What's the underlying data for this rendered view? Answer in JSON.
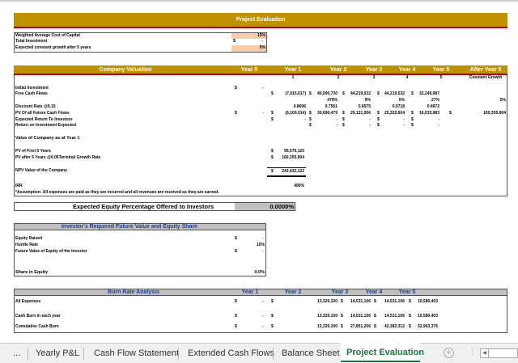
{
  "title": "Project Evaluation",
  "colors": {
    "header": "#bf9000",
    "header_border": "#b00000",
    "input_fill": "#f8cbad",
    "gray": "#c0c0c0",
    "tab_active": "#217346",
    "blue_text": "#1f3f8f"
  },
  "inputs": {
    "wacc_label": "Weighted Average Cost of Capital",
    "wacc": "15%",
    "investment_label": "Total Investment",
    "investment_cur": "$",
    "investment": "-",
    "growth_label": "Expected constant growth after 5 years",
    "growth": "5%"
  },
  "valuation": {
    "title": "Company Valuation",
    "columns": [
      "Year 0",
      "Year 1",
      "Year 2",
      "Year 3",
      "Year 4",
      "Year 5",
      "After Year 5"
    ],
    "period_numbers": [
      "1",
      "2",
      "3",
      "4",
      "5",
      "Constant Growth"
    ],
    "initial_investment": {
      "label": "Initial Investment",
      "cur": "$",
      "value": "-"
    },
    "fcf": {
      "label": "Free Cash Flows",
      "values": [
        "(7,015,017)",
        "40,590,730",
        "44,219,532",
        "44,219,532",
        "32,249,987"
      ]
    },
    "fcf_growth": [
      "479%",
      "9%",
      "0%",
      "27%",
      "5%"
    ],
    "discount": {
      "label": "Discount Rate @0.15",
      "values": [
        "0.8696",
        "0.7561",
        "0.6575",
        "0.5718",
        "0.4972"
      ]
    },
    "pv": {
      "label": "PV Of all Future Cash Flows",
      "year0": "-",
      "values": [
        "(6,100,014)",
        "30,690,479",
        "29,121,006",
        "25,322,604",
        "16,033,983",
        "160,355,904"
      ]
    },
    "expected_returns": {
      "label": "Expected Return To Investors",
      "values": [
        "-",
        "-",
        "-",
        "-",
        "-"
      ]
    },
    "roi": {
      "label": "Return on Investment Expected",
      "values": [
        "-",
        "-",
        "-",
        "-"
      ]
    },
    "company_value_title": "Value of Company as at Year 1",
    "pv_first5": {
      "label": "PV of First 5 Years",
      "value": "95,076,120"
    },
    "pv_after5": {
      "label": "PV after 5 Years @0.05Terminal Growth Rate",
      "value": "160,355,904"
    },
    "npv": {
      "label": "NPV Value of the Company",
      "value": "243,432,122"
    },
    "irr": {
      "label": "IRR",
      "value": "490%"
    },
    "assumption": "*Assumption- All expenses are paid as they are incurred and all revenues are received as they are earned.",
    "currency": "$"
  },
  "equity_offer": {
    "label": "Expected Equity Percentage Offered to Investors",
    "value": "0.0000%"
  },
  "investor": {
    "title": "Investor's Required Future Value and Equity Share",
    "equity_raised_label": "Equity Raised",
    "equity_raised": "-",
    "hurdle_label": "Hurdle Rate",
    "hurdle": "15%",
    "fv_label": "Future Value of Equity of the Investor",
    "fv": "-",
    "share_label": "Share in Equity",
    "share": "0.0%"
  },
  "burn": {
    "title": "Burn Rate Analysis",
    "columns": [
      "Year 1",
      "Year 2",
      "Year 3",
      "Year 4",
      "Year 5"
    ],
    "rows": [
      {
        "label": "All Expenses",
        "values": [
          "-",
          "13,320,100",
          "14,531,106",
          "14,531,106",
          "10,580,403"
        ]
      },
      {
        "label": "Cash Burn in each year",
        "values": [
          "-",
          "13,320,100",
          "14,531,106",
          "14,531,106",
          "10,580,403"
        ]
      },
      {
        "label": "Cumulative Cash Burn",
        "values": [
          "-",
          "13,320,100",
          "27,851,206",
          "42,382,312",
          "52,963,376"
        ]
      }
    ]
  },
  "tabs": {
    "more": "...",
    "items": [
      "Yearly P&L",
      "Cash Flow Statement",
      "Extended Cash Flows",
      "Balance Sheet",
      "Project Evaluation"
    ],
    "active": "Project Evaluation"
  }
}
